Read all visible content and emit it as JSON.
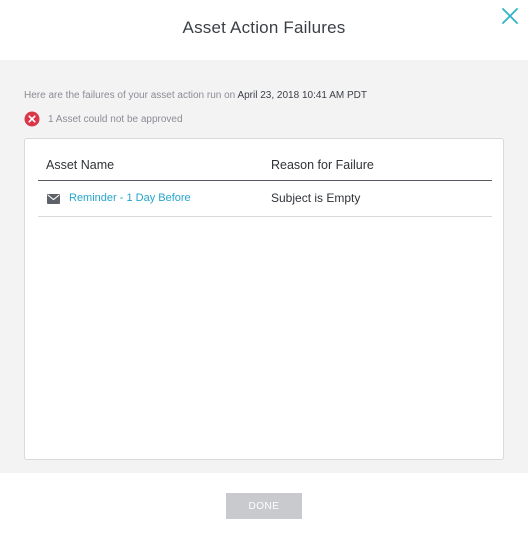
{
  "dialog": {
    "title": "Asset Action Failures",
    "close_icon": "close-x-icon"
  },
  "summary": {
    "prefix": "Here are the failures of your asset action run on ",
    "timestamp": "April 23, 2018 10:41 AM PDT"
  },
  "status": {
    "icon": "error-circle-icon",
    "text": "1 Asset could not be approved"
  },
  "table": {
    "headers": [
      "Asset Name",
      "Reason for Failure"
    ],
    "rows": [
      {
        "icon": "envelope-icon",
        "asset_name": "Reminder - 1 Day Before",
        "reason": "Subject is Empty"
      }
    ]
  },
  "footer": {
    "done_label": "DONE"
  },
  "colors": {
    "accent": "#25a6cf",
    "close": "#2fb3c9",
    "error": "#d9374a",
    "button_disabled": "#c9cacd"
  }
}
